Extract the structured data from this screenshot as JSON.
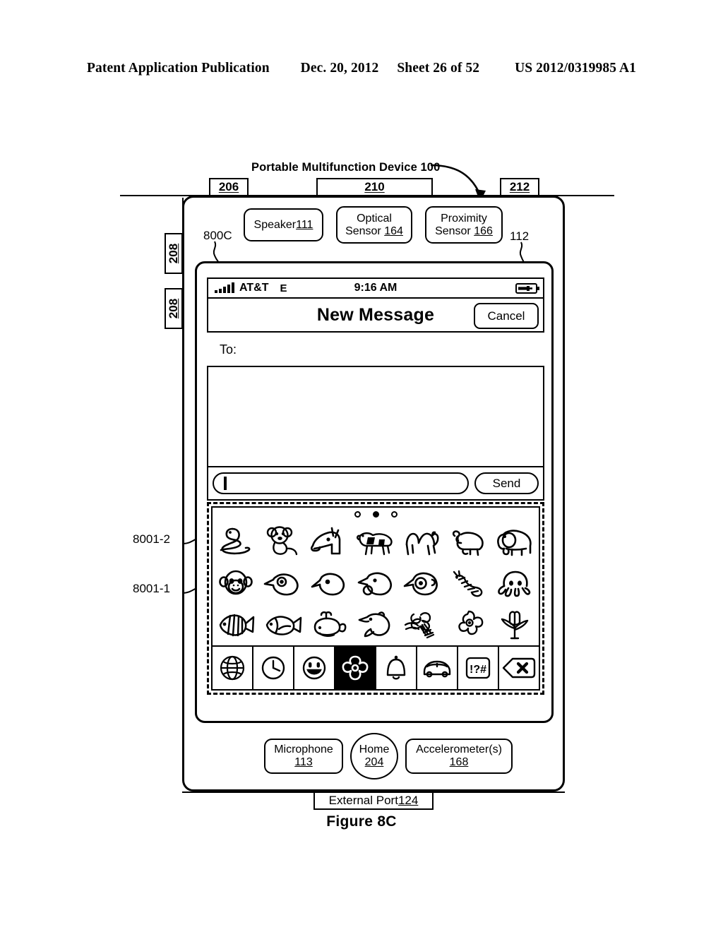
{
  "patent_header": {
    "publication": "Patent Application Publication",
    "date": "Dec. 20, 2012",
    "sheet": "Sheet 26 of 52",
    "number": "US 2012/0319985 A1"
  },
  "figure_caption": "Figure 8C",
  "device": {
    "title": "Portable Multifunction Device 100",
    "top_callouts": [
      {
        "id": "206",
        "label": "206"
      },
      {
        "id": "210",
        "label": "210"
      },
      {
        "id": "212",
        "label": "212"
      }
    ],
    "side_callouts": [
      {
        "id": "208-a",
        "label": "208"
      },
      {
        "id": "208-b",
        "label": "208"
      }
    ],
    "reference_numerals": {
      "ui_800c": "800C",
      "screen_112": "112",
      "emoji_row1": "8001-2",
      "emoji_row2": "8001-1"
    },
    "hardware": {
      "speaker": {
        "line1": "Speaker",
        "num": "111"
      },
      "optical_sensor": {
        "line1": "Optical",
        "line2": "Sensor",
        "num": "164"
      },
      "proximity_sensor": {
        "line1": "Proximity",
        "line2": "Sensor",
        "num": "166"
      },
      "microphone": {
        "line1": "Microphone",
        "num": "113"
      },
      "home": {
        "line1": "Home",
        "num": "204"
      },
      "accelerometer": {
        "line1": "Accelerometer(s)",
        "num": "168"
      },
      "external_port": {
        "line1": "External Port",
        "num": "124"
      }
    }
  },
  "screen": {
    "status_bar": {
      "signal_icon": "signal-bars-icon",
      "signal_bar_count": 5,
      "carrier": "AT&T",
      "network_type": "E",
      "time": "9:16 AM",
      "battery_icon": "battery-charging-icon"
    },
    "nav_bar": {
      "title": "New Message",
      "cancel_label": "Cancel"
    },
    "to_field": {
      "label": "To:",
      "value": ""
    },
    "message_body": {
      "value": ""
    },
    "compose": {
      "input_value": "",
      "input_placeholder": "",
      "send_label": "Send"
    },
    "emoji_keyboard": {
      "page_dots": {
        "count": 3,
        "active_index": 1
      },
      "rows": [
        [
          {
            "name": "snake-emoji"
          },
          {
            "name": "koala-emoji"
          },
          {
            "name": "horse-emoji"
          },
          {
            "name": "cow-emoji"
          },
          {
            "name": "camel-emoji"
          },
          {
            "name": "ram-emoji"
          },
          {
            "name": "elephant-emoji"
          }
        ],
        [
          {
            "name": "monkey-face-emoji"
          },
          {
            "name": "bird-emoji"
          },
          {
            "name": "baby-chick-emoji"
          },
          {
            "name": "hatching-chick-emoji"
          },
          {
            "name": "front-facing-chick-emoji"
          },
          {
            "name": "bug-emoji"
          },
          {
            "name": "octopus-emoji"
          }
        ],
        [
          {
            "name": "tropical-fish-emoji"
          },
          {
            "name": "fish-emoji"
          },
          {
            "name": "whale-emoji"
          },
          {
            "name": "dolphin-emoji"
          },
          {
            "name": "bouquet-emoji"
          },
          {
            "name": "cherry-blossom-emoji"
          },
          {
            "name": "tulip-emoji"
          }
        ]
      ],
      "tabs": [
        {
          "name": "globe-icon",
          "selected": false
        },
        {
          "name": "clock-icon",
          "selected": false
        },
        {
          "name": "smiley-icon",
          "selected": false
        },
        {
          "name": "flower-icon",
          "selected": true
        },
        {
          "name": "bell-icon",
          "selected": false
        },
        {
          "name": "car-icon",
          "selected": false
        },
        {
          "name": "punctuation-icon",
          "label": "!?#",
          "selected": false
        },
        {
          "name": "delete-icon",
          "selected": false
        }
      ]
    }
  }
}
